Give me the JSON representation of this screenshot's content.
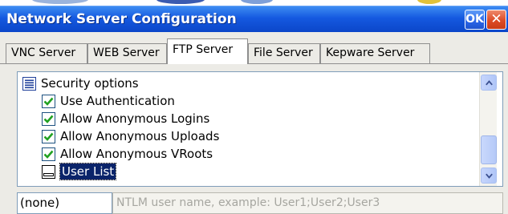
{
  "window": {
    "title": "Network Server Configuration",
    "ok_label": "OK",
    "close_label": "✕"
  },
  "tabs": [
    {
      "label": "VNC Server",
      "active": false
    },
    {
      "label": "WEB Server",
      "active": false
    },
    {
      "label": "FTP Server",
      "active": true
    },
    {
      "label": "File Server",
      "active": false
    },
    {
      "label": "Kepware Server",
      "active": false
    }
  ],
  "options": {
    "group_label": "Security options",
    "items": [
      {
        "label": "Use Authentication",
        "checked": true
      },
      {
        "label": "Allow Anonymous Logins",
        "checked": true
      },
      {
        "label": "Allow Anonymous Uploads",
        "checked": true
      },
      {
        "label": "Allow Anonymous VRoots",
        "checked": true
      },
      {
        "label": "User List",
        "checked": false,
        "selected": true
      }
    ]
  },
  "value_field": {
    "value": "(none)"
  },
  "hint_field": {
    "text": "NTLM user name, example: User1;User2;User3"
  },
  "colors": {
    "titlebar": "#1559e0",
    "selection": "#0a246a",
    "check": "#21a121"
  },
  "icons": {
    "group": "list-group-icon",
    "check": "checkmark-icon",
    "scroll_up": "chevron-up-icon",
    "scroll_down": "chevron-down-icon"
  }
}
